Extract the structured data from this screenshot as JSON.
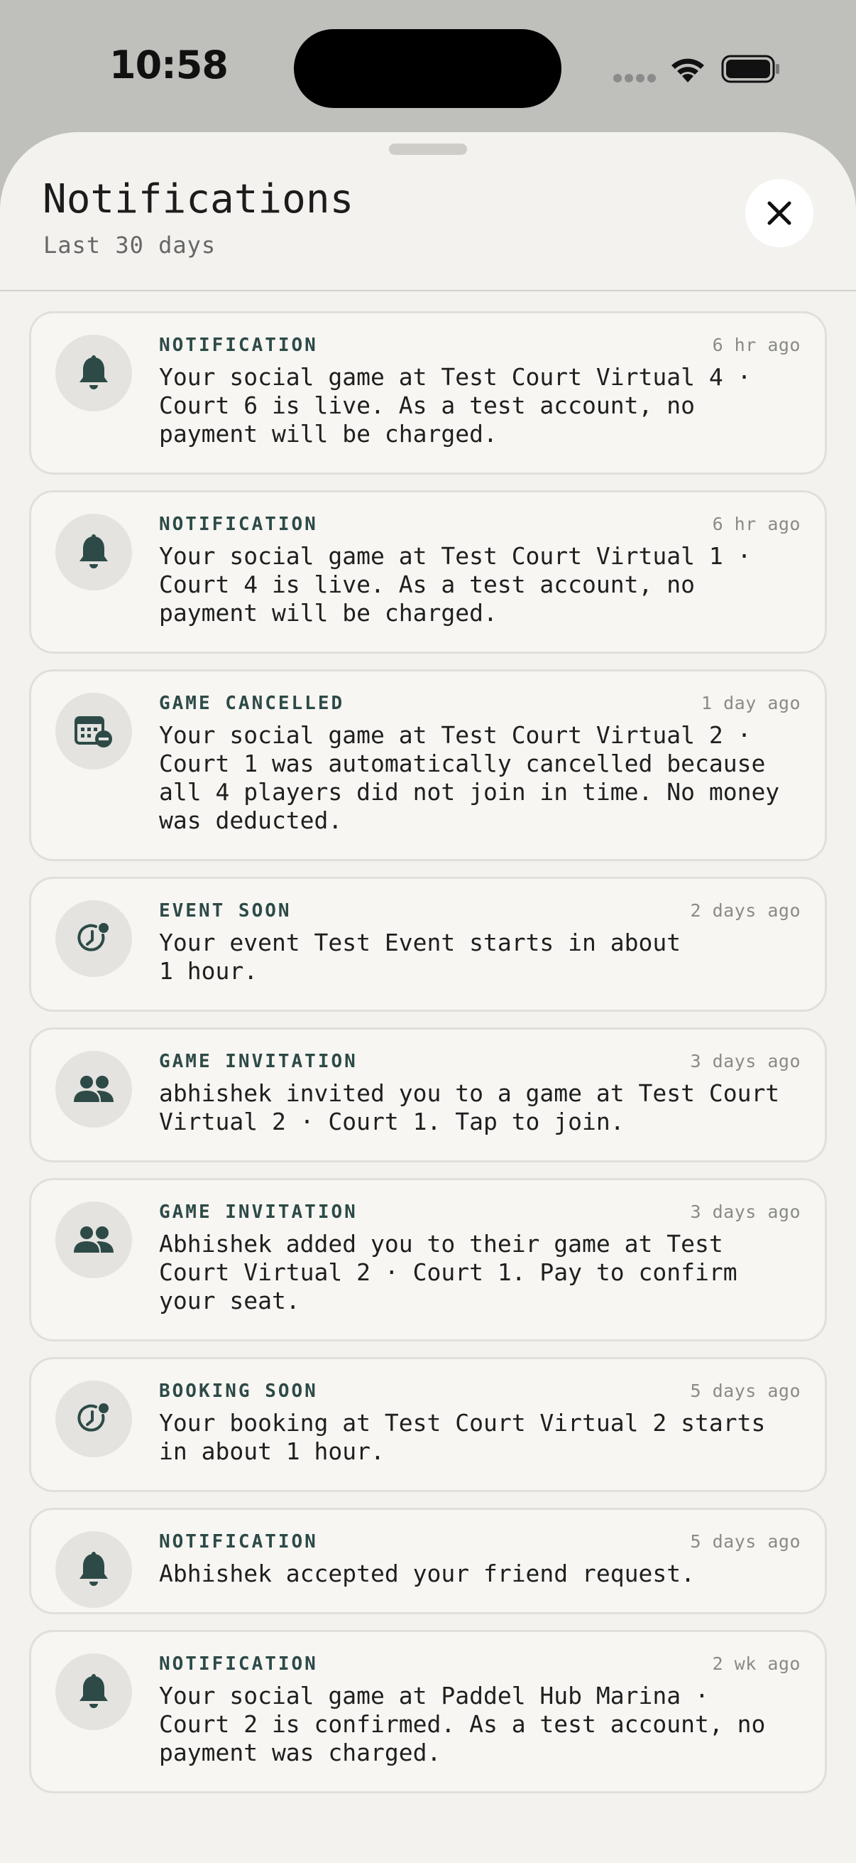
{
  "status_bar": {
    "time": "10:58"
  },
  "sheet": {
    "title": "Notifications",
    "subtitle": "Last 30 days"
  },
  "colors": {
    "accent": "#2d4a47",
    "sheet_bg": "#f3f2ee",
    "card_bg": "#f7f6f3",
    "icon_bg": "#e4e3df"
  },
  "notifications": [
    {
      "type": "NOTIFICATION",
      "time": "6 hr ago",
      "icon": "bell-icon",
      "body": "Your social game at Test Court Virtual 4 ·\nCourt 6 is live. As a test account, no\npayment will be charged."
    },
    {
      "type": "NOTIFICATION",
      "time": "6 hr ago",
      "icon": "bell-icon",
      "body": "Your social game at Test Court Virtual 1 ·\nCourt 4 is live. As a test account, no\npayment will be charged."
    },
    {
      "type": "GAME CANCELLED",
      "time": "1 day ago",
      "icon": "calendar-cancel-icon",
      "body": "Your social game at Test Court Virtual 2 ·\nCourt 1 was automatically cancelled because\nall 4 players did not join in time. No money\nwas deducted."
    },
    {
      "type": "EVENT SOON",
      "time": "2 days ago",
      "icon": "clock-alert-icon",
      "body": "Your event Test Event starts in about\n1 hour."
    },
    {
      "type": "GAME INVITATION",
      "time": "3 days ago",
      "icon": "group-icon",
      "body": "abhishek invited you to a game at Test Court\nVirtual 2 · Court 1. Tap to join."
    },
    {
      "type": "GAME INVITATION",
      "time": "3 days ago",
      "icon": "group-icon",
      "body": "Abhishek added you to their game at Test\nCourt Virtual 2 · Court 1. Pay to confirm\nyour seat."
    },
    {
      "type": "BOOKING SOON",
      "time": "5 days ago",
      "icon": "clock-alert-icon",
      "body": "Your booking at Test Court Virtual 2 starts\nin about 1 hour."
    },
    {
      "type": "NOTIFICATION",
      "time": "5 days ago",
      "icon": "bell-icon",
      "body": "Abhishek accepted your friend request."
    },
    {
      "type": "NOTIFICATION",
      "time": "2 wk ago",
      "icon": "bell-icon",
      "body": "Your social game at Paddel Hub Marina ·\nCourt 2 is confirmed. As a test account, no\npayment was charged."
    }
  ]
}
